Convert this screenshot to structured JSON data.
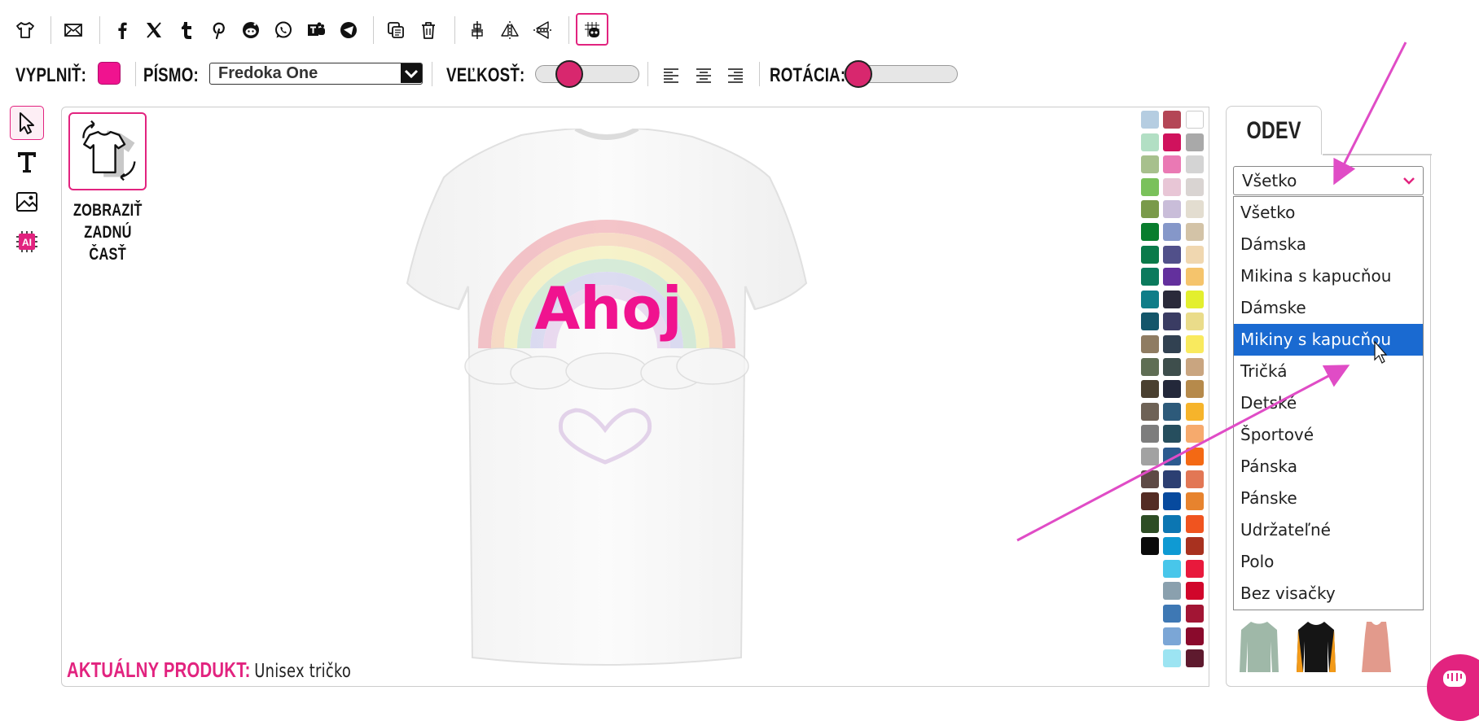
{
  "toolbar": {
    "icons": [
      "shirt-icon",
      "email-icon",
      "facebook-icon",
      "x-icon",
      "tumblr-icon",
      "pinterest-icon",
      "reddit-icon",
      "whatsapp-icon",
      "teams-icon",
      "telegram-icon",
      "duplicate-icon",
      "trash-icon",
      "align-center-icon",
      "flip-horizontal-icon",
      "flip-vertical-icon",
      "grid-toggle-icon"
    ]
  },
  "format": {
    "fill_label": "VYPLNIŤ:",
    "fill_color": "#f0138f",
    "font_label": "PÍSMO:",
    "font_value": "Fredoka One",
    "size_label": "VEĽKOSŤ:",
    "size_level": 0.25,
    "rotation_label": "ROTÁCIA:",
    "rotation_level": 0.0
  },
  "left_tools": [
    "select-tool-icon",
    "text-tool-icon",
    "image-tool-icon",
    "ai-tool-icon"
  ],
  "canvas": {
    "back_label_1": "ZOBRAZIŤ",
    "back_label_2": "ZADNÚ",
    "back_label_3": "ČASŤ",
    "design_text": "Ahoj",
    "product_key": "AKTUÁLNY PRODUKT:",
    "product_value": "Unisex tričko"
  },
  "palette_left": [
    "#b5cde1",
    "#b2dfc4",
    "#a7c08d",
    "#7ac15b",
    "#7a9a4a",
    "#087d2d",
    "#0a7a4a",
    "#0b7a5d",
    "#0f7d88",
    "#14566a",
    "#8f7c62",
    "#5f6e54",
    "#4a4030",
    "#6e6256",
    "#7d7d7d",
    "#a2a2a2",
    "#5e4a45",
    "#542c24",
    "#2d4d24",
    "#0a0a0a"
  ],
  "palette_mid": [
    "#b44656",
    "#d0125d",
    "#ea79b4",
    "#e8c6d6",
    "#c9bdd9",
    "#8597c9",
    "#51508a",
    "#63309d",
    "#2a2a3a",
    "#3a3c63",
    "#314151",
    "#3e4e4c",
    "#23283a",
    "#2d5a7a",
    "#264e5e",
    "#2c5a8f",
    "#2c3f72",
    "#074a9e",
    "#0c76b2",
    "#0f9ad3",
    "#48c6ea",
    "#8aa0ae",
    "#3e78b4",
    "#7ba6d6",
    "#9ce4f2"
  ],
  "palette_right": [
    "#ffffff",
    "#a9a9a9",
    "#d4d4d4",
    "#d9d4d2",
    "#e3ddd0",
    "#d3c3a7",
    "#f0d7b0",
    "#f5c46c",
    "#e3ef2e",
    "#eadc8a",
    "#f9ea5e",
    "#c9a580",
    "#b68a4b",
    "#f6b42b",
    "#f6aa6d",
    "#f46914",
    "#e27755",
    "#e7832e",
    "#f0541f",
    "#a8311f",
    "#e8193c",
    "#d1062b",
    "#a21534",
    "#8a0a2c",
    "#5e1a2e"
  ],
  "panel": {
    "tab_label": "ODEV",
    "category_value": "Všetko",
    "options": [
      "Všetko",
      "Dámska",
      "Mikina s kapucňou",
      "Dámske",
      "Mikiny s kapucňou",
      "Tričká",
      "Detské",
      "Športové",
      "Pánska",
      "Pánske",
      "Udržateľné",
      "Polo",
      "Bez visačky"
    ],
    "selected_index": 4
  },
  "colors": {
    "accent": "#e2237f",
    "selected": "#1a6ad1",
    "arrow": "#e04cc6"
  }
}
